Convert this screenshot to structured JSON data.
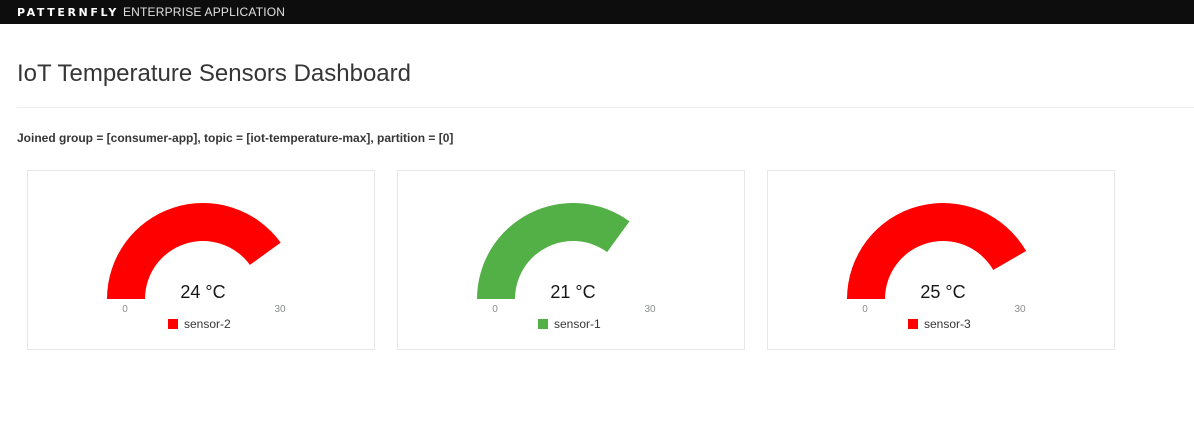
{
  "header": {
    "brand_name": "PATTERNFLY",
    "brand_subtitle": "ENTERPRISE APPLICATION"
  },
  "page": {
    "title": "IoT Temperature Sensors Dashboard",
    "status": "Joined group = [consumer-app], topic = [iot-temperature-max], partition = [0]"
  },
  "colors": {
    "alert": "#ff0000",
    "ok": "#52b046",
    "track": "#ffffff"
  },
  "chart_data": [
    {
      "type": "gauge",
      "series": [
        {
          "name": "sensor-2",
          "value": 24,
          "color": "#ff0000"
        }
      ],
      "value_label": "24 °C",
      "unit": "°C",
      "range": [
        0,
        30
      ],
      "min_label": "0",
      "max_label": "30"
    },
    {
      "type": "gauge",
      "series": [
        {
          "name": "sensor-1",
          "value": 21,
          "color": "#52b046"
        }
      ],
      "value_label": "21 °C",
      "unit": "°C",
      "range": [
        0,
        30
      ],
      "min_label": "0",
      "max_label": "30"
    },
    {
      "type": "gauge",
      "series": [
        {
          "name": "sensor-3",
          "value": 25,
          "color": "#ff0000"
        }
      ],
      "value_label": "25 °C",
      "unit": "°C",
      "range": [
        0,
        30
      ],
      "min_label": "0",
      "max_label": "30"
    }
  ]
}
